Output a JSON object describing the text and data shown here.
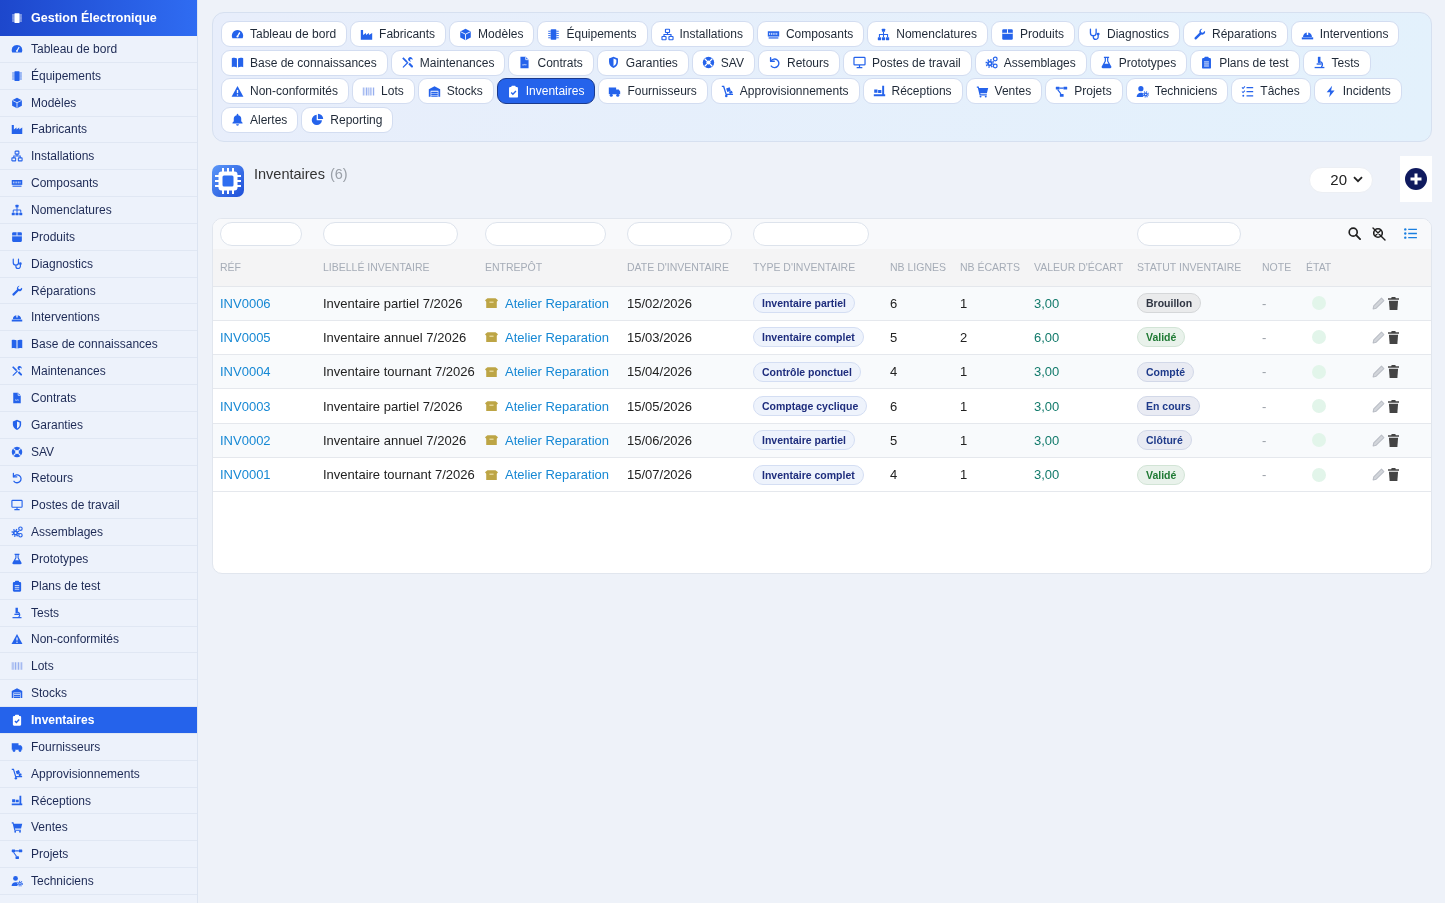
{
  "sidebar": {
    "title": "Gestion Électronique",
    "items": [
      {
        "label": "Tableau de bord",
        "selected": false
      },
      {
        "label": "Équipements",
        "selected": false
      },
      {
        "label": "Modèles",
        "selected": false
      },
      {
        "label": "Fabricants",
        "selected": false
      },
      {
        "label": "Installations",
        "selected": false
      },
      {
        "label": "Composants",
        "selected": false
      },
      {
        "label": "Nomenclatures",
        "selected": false
      },
      {
        "label": "Produits",
        "selected": false
      },
      {
        "label": "Diagnostics",
        "selected": false
      },
      {
        "label": "Réparations",
        "selected": false
      },
      {
        "label": "Interventions",
        "selected": false
      },
      {
        "label": "Base de connaissances",
        "selected": false
      },
      {
        "label": "Maintenances",
        "selected": false
      },
      {
        "label": "Contrats",
        "selected": false
      },
      {
        "label": "Garanties",
        "selected": false
      },
      {
        "label": "SAV",
        "selected": false
      },
      {
        "label": "Retours",
        "selected": false
      },
      {
        "label": "Postes de travail",
        "selected": false
      },
      {
        "label": "Assemblages",
        "selected": false
      },
      {
        "label": "Prototypes",
        "selected": false
      },
      {
        "label": "Plans de test",
        "selected": false
      },
      {
        "label": "Tests",
        "selected": false
      },
      {
        "label": "Non-conformités",
        "selected": false
      },
      {
        "label": "Lots",
        "selected": false
      },
      {
        "label": "Stocks",
        "selected": false
      },
      {
        "label": "Inventaires",
        "selected": true
      },
      {
        "label": "Fournisseurs",
        "selected": false
      },
      {
        "label": "Approvisionnements",
        "selected": false
      },
      {
        "label": "Réceptions",
        "selected": false
      },
      {
        "label": "Ventes",
        "selected": false
      },
      {
        "label": "Projets",
        "selected": false
      },
      {
        "label": "Techniciens",
        "selected": false
      }
    ]
  },
  "tabs": {
    "rows": [
      [
        {
          "label": "Tableau de bord",
          "selected": false
        },
        {
          "label": "Fabricants",
          "selected": false
        },
        {
          "label": "Modèles",
          "selected": false
        },
        {
          "label": "Équipements",
          "selected": false
        },
        {
          "label": "Installations",
          "selected": false
        },
        {
          "label": "Composants",
          "selected": false
        },
        {
          "label": "Nomenclatures",
          "selected": false
        },
        {
          "label": "Produits",
          "selected": false
        },
        {
          "label": "Diagnostics",
          "selected": false
        },
        {
          "label": "Réparations",
          "selected": false
        },
        {
          "label": "Interventions",
          "selected": false
        }
      ],
      [
        {
          "label": "Base de connaissances",
          "selected": false
        },
        {
          "label": "Maintenances",
          "selected": false
        },
        {
          "label": "Contrats",
          "selected": false
        },
        {
          "label": "Garanties",
          "selected": false
        },
        {
          "label": "SAV",
          "selected": false
        },
        {
          "label": "Retours",
          "selected": false
        },
        {
          "label": "Postes de travail",
          "selected": false
        },
        {
          "label": "Assemblages",
          "selected": false
        },
        {
          "label": "Prototypes",
          "selected": false
        },
        {
          "label": "Plans de test",
          "selected": false
        },
        {
          "label": "Tests",
          "selected": false
        }
      ],
      [
        {
          "label": "Non-conformités",
          "selected": false
        },
        {
          "label": "Lots",
          "selected": false
        },
        {
          "label": "Stocks",
          "selected": false
        },
        {
          "label": "Inventaires",
          "selected": true
        },
        {
          "label": "Fournisseurs",
          "selected": false
        },
        {
          "label": "Approvisionnements",
          "selected": false
        },
        {
          "label": "Réceptions",
          "selected": false
        },
        {
          "label": "Ventes",
          "selected": false
        },
        {
          "label": "Projets",
          "selected": false
        },
        {
          "label": "Techniciens",
          "selected": false
        },
        {
          "label": "Tâches",
          "selected": false
        },
        {
          "label": "Incidents",
          "selected": false
        }
      ],
      [
        {
          "label": "Alertes",
          "selected": false
        },
        {
          "label": "Reporting",
          "selected": false
        }
      ]
    ]
  },
  "page": {
    "title": "Inventaires",
    "count": "(6)",
    "page_size": "20"
  },
  "table": {
    "columns": [
      {
        "label": "RÉF",
        "filter": true
      },
      {
        "label": "LIBELLÉ INVENTAIRE",
        "filter": true
      },
      {
        "label": "ENTREPÔT",
        "filter": true
      },
      {
        "label": "DATE D'INVENTAIRE",
        "filter": true
      },
      {
        "label": "TYPE D'INVENTAIRE",
        "filter": true
      },
      {
        "label": "NB LIGNES",
        "filter": false
      },
      {
        "label": "NB ÉCARTS",
        "filter": false
      },
      {
        "label": "VALEUR D'ÉCART",
        "filter": false
      },
      {
        "label": "STATUT INVENTAIRE",
        "filter": true
      },
      {
        "label": "NOTE",
        "filter": false
      },
      {
        "label": "ÉTAT",
        "filter": false
      }
    ],
    "rows": [
      {
        "ref": "INV0006",
        "label": "Inventaire partiel 7/2026",
        "warehouse": "Atelier Reparation",
        "date": "15/02/2026",
        "type": "Inventaire partiel",
        "lines": "6",
        "gaps": "1",
        "gap_value": "3,00",
        "status": {
          "label": "Brouillon",
          "color": "#2f3542"
        },
        "note": "-",
        "state_dot": {
          "color": "#e2f5ea"
        }
      },
      {
        "ref": "INV0005",
        "label": "Inventaire annuel 7/2026",
        "warehouse": "Atelier Reparation",
        "date": "15/03/2026",
        "type": "Inventaire complet",
        "lines": "5",
        "gaps": "2",
        "gap_value": "6,00",
        "status": {
          "label": "Validé",
          "color": "#1f7a34"
        },
        "note": "-",
        "state_dot": {
          "color": "#e2f5ea"
        }
      },
      {
        "ref": "INV0004",
        "label": "Inventaire tournant 7/2026",
        "warehouse": "Atelier Reparation",
        "date": "15/04/2026",
        "type": "Contrôle ponctuel",
        "lines": "4",
        "gaps": "1",
        "gap_value": "3,00",
        "status": {
          "label": "Compté",
          "color": "#1e3a8a"
        },
        "note": "-",
        "state_dot": {
          "color": "#e2f5ea"
        }
      },
      {
        "ref": "INV0003",
        "label": "Inventaire partiel 7/2026",
        "warehouse": "Atelier Reparation",
        "date": "15/05/2026",
        "type": "Comptage cyclique",
        "lines": "6",
        "gaps": "1",
        "gap_value": "3,00",
        "status": {
          "label": "En cours",
          "color": "#1e3a8a"
        },
        "note": "-",
        "state_dot": {
          "color": "#e2f5ea"
        }
      },
      {
        "ref": "INV0002",
        "label": "Inventaire annuel 7/2026",
        "warehouse": "Atelier Reparation",
        "date": "15/06/2026",
        "type": "Inventaire partiel",
        "lines": "5",
        "gaps": "1",
        "gap_value": "3,00",
        "status": {
          "label": "Clôturé",
          "color": "#1e3a8a"
        },
        "note": "-",
        "state_dot": {
          "color": "#e2f5ea"
        }
      },
      {
        "ref": "INV0001",
        "label": "Inventaire tournant 7/2026",
        "warehouse": "Atelier Reparation",
        "date": "15/07/2026",
        "type": "Inventaire complet",
        "lines": "4",
        "gaps": "1",
        "gap_value": "3,00",
        "status": {
          "label": "Validé",
          "color": "#1f7a34"
        },
        "note": "-",
        "state_dot": {
          "color": "#e2f5ea"
        }
      }
    ]
  }
}
